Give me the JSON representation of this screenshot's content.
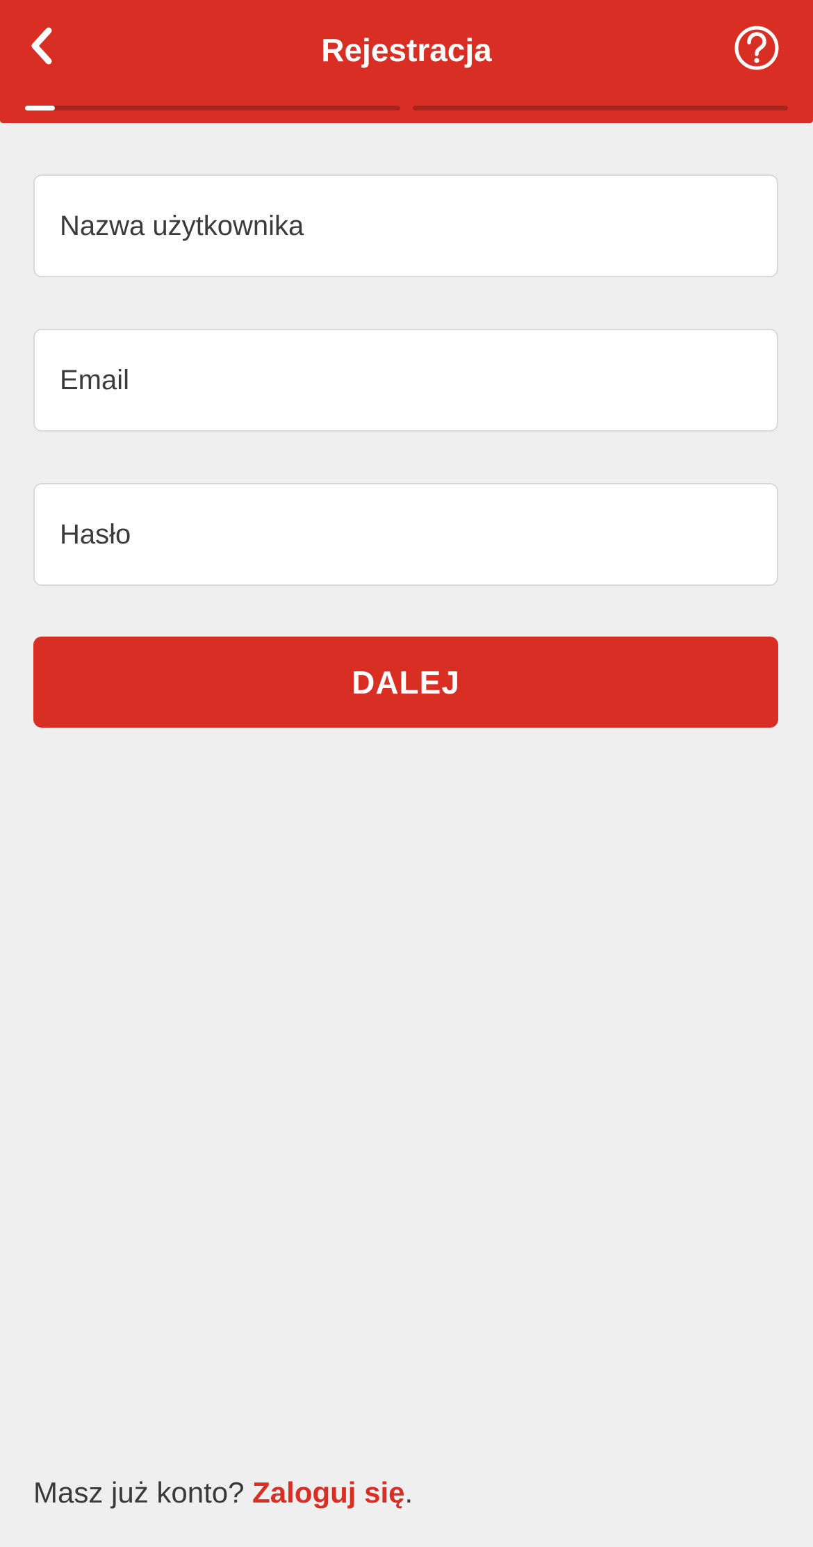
{
  "header": {
    "title": "Rejestracja",
    "back_icon": "chevron-left-icon",
    "help_icon": "question-circle-icon",
    "progress_steps": [
      {
        "fill_fraction": 0.08
      },
      {
        "fill_fraction": 0
      }
    ]
  },
  "form": {
    "username_placeholder": "Nazwa użytkownika",
    "email_placeholder": "Email",
    "password_placeholder": "Hasło",
    "next_label": "DALEJ"
  },
  "footer": {
    "prompt": "Masz już konto? ",
    "login_link": "Zaloguj się",
    "period": "."
  },
  "colors": {
    "accent": "#d92e24",
    "background": "#efefef",
    "progress_track": "#a8231b"
  }
}
